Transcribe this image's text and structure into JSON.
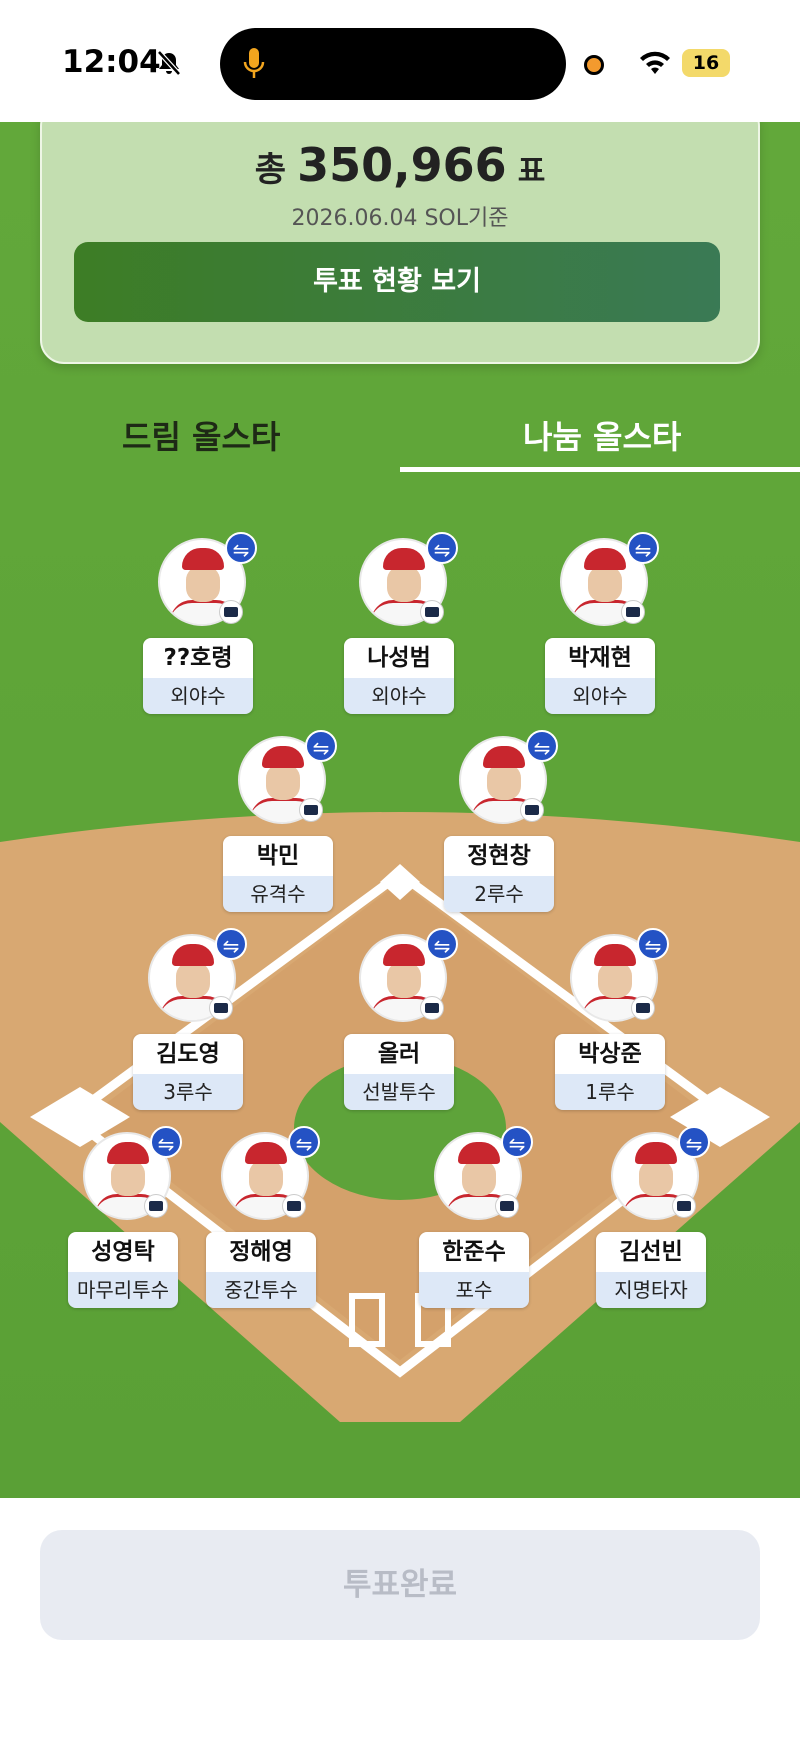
{
  "status_bar": {
    "time": "12:04",
    "battery": "16"
  },
  "summary": {
    "prefix": "총",
    "total_votes": "350,966",
    "suffix": "표",
    "as_of": "2026.06.04 SOL기준",
    "button": "투표 현황 보기"
  },
  "tabs": [
    {
      "label": "드림 올스타",
      "active": false
    },
    {
      "label": "나눔 올스타",
      "active": true
    }
  ],
  "swap_icon": "⇋",
  "players": [
    {
      "name": "??호령",
      "position": "외야수"
    },
    {
      "name": "나성범",
      "position": "외야수"
    },
    {
      "name": "박재현",
      "position": "외야수"
    },
    {
      "name": "박민",
      "position": "유격수"
    },
    {
      "name": "정현창",
      "position": "2루수"
    },
    {
      "name": "김도영",
      "position": "3루수"
    },
    {
      "name": "올러",
      "position": "선발투수"
    },
    {
      "name": "박상준",
      "position": "1루수"
    },
    {
      "name": "성영탁",
      "position": "마무리투수"
    },
    {
      "name": "정해영",
      "position": "중간투수"
    },
    {
      "name": "한준수",
      "position": "포수"
    },
    {
      "name": "김선빈",
      "position": "지명타자"
    }
  ],
  "vote_complete": "투표완료",
  "colors": {
    "field_green": "#5aa036",
    "infield_dirt": "#d8a872",
    "card": "#c3deb0",
    "button_green": "#3d7d25",
    "swap_blue": "#2452c4"
  }
}
